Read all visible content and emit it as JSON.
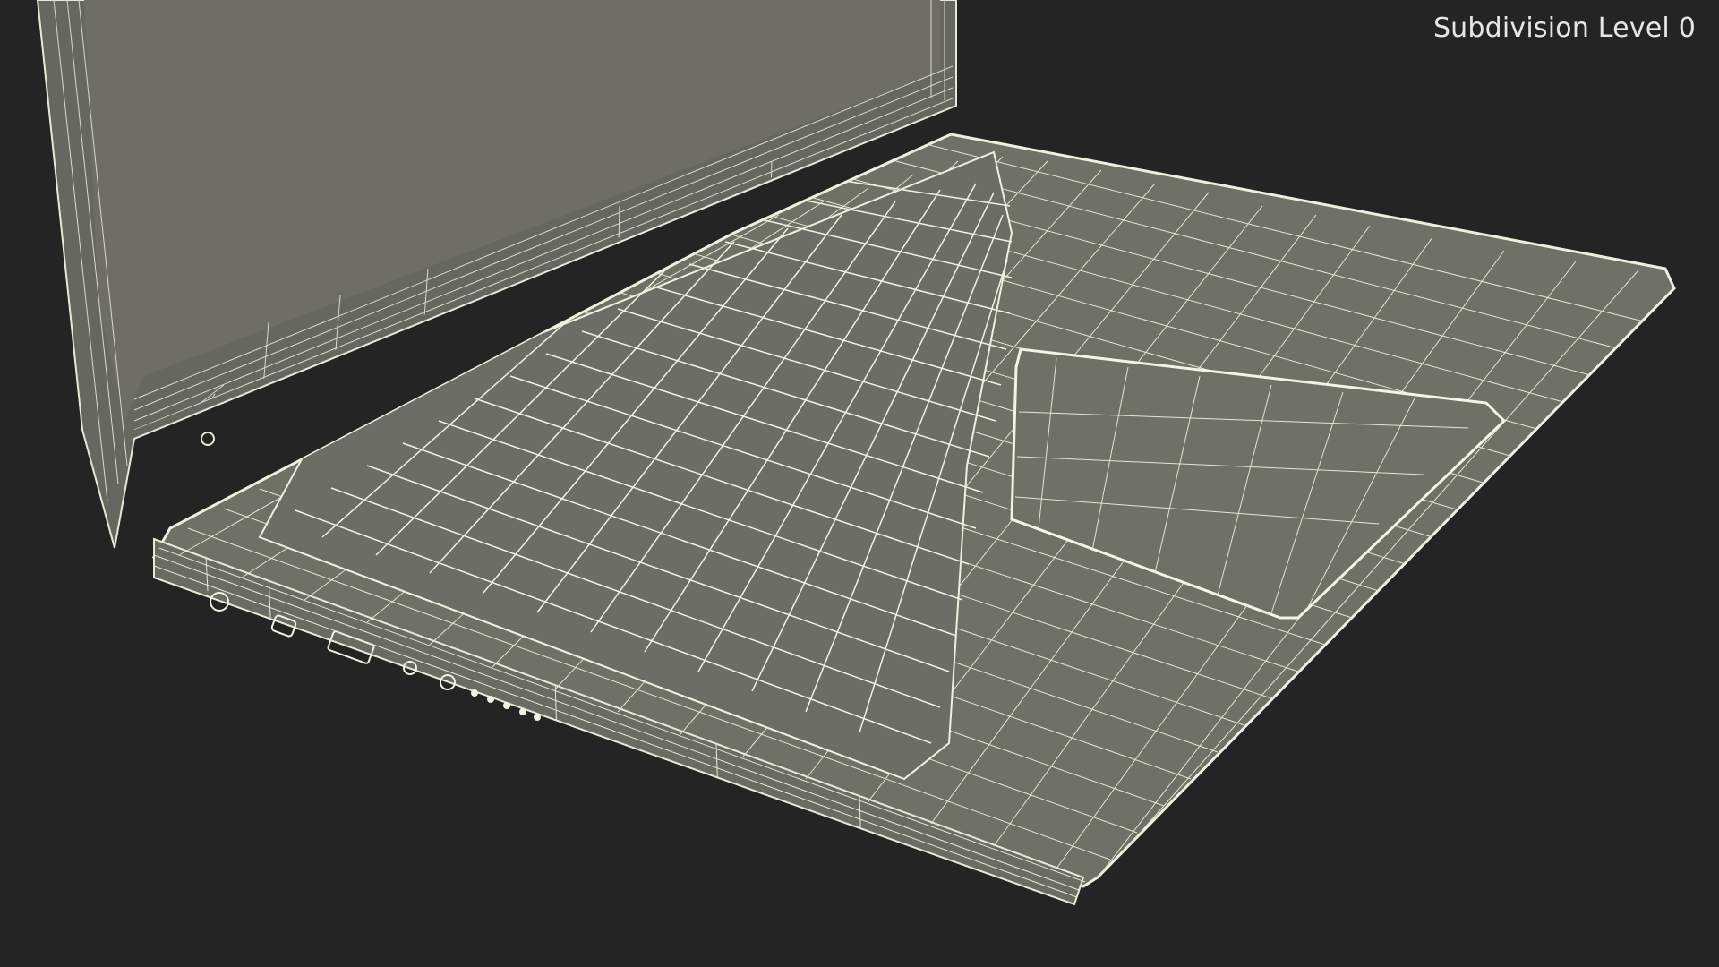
{
  "render": {
    "subdivision_label": "Subdivision Level 0"
  },
  "scene": {
    "subject": "laptop-wireframe",
    "colors": {
      "background": "#242424",
      "surface": "#6e6f65",
      "screen": "#6b6b63",
      "wire": "#e7e9d8",
      "wire_dim": "#c9cbbb"
    }
  }
}
